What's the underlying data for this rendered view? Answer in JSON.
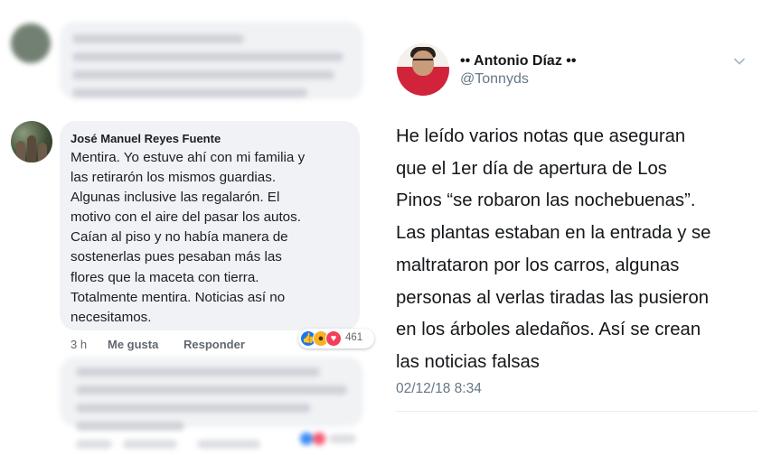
{
  "facebook_comment": {
    "author": "José Manuel Reyes Fuente",
    "lines": [
      "Mentira. Yo estuve ahí con mi familia y",
      "las retirarón los mismos guardias.",
      "Algunas inclusive las regalarón. El",
      "motivo con el aire del pasar los autos.",
      "Caían al piso y no había manera de",
      "sostenerlas pues pesaban más las",
      "flores que la maceta con tierra.",
      "Totalmente mentira. Noticias así no",
      "necesitamos."
    ],
    "time": "3 h",
    "like_action": "Me gusta",
    "reply_action": "Responder",
    "reaction_count": "461",
    "reaction_icons": [
      "like-icon",
      "wow-icon",
      "love-icon"
    ],
    "colors": {
      "like": "#1877f2",
      "wow": "#f7b125",
      "love": "#f33e58"
    }
  },
  "tweet": {
    "display_name": "•• Antonio Díaz ••",
    "handle": "@Tonnyds",
    "lines": [
      "He leído varios notas que aseguran",
      "que el 1er día de apertura de Los",
      "Pinos “se robaron las nochebuenas”.",
      "Las plantas estaban en la entrada y se",
      "maltrataron por los carros, algunas",
      "personas al verlas tiradas las pusieron",
      "en los árboles aledaños. Así se crean",
      "las noticias falsas"
    ],
    "timestamp": "02/12/18 8:34",
    "menu_icon": "chevron-down-icon"
  }
}
